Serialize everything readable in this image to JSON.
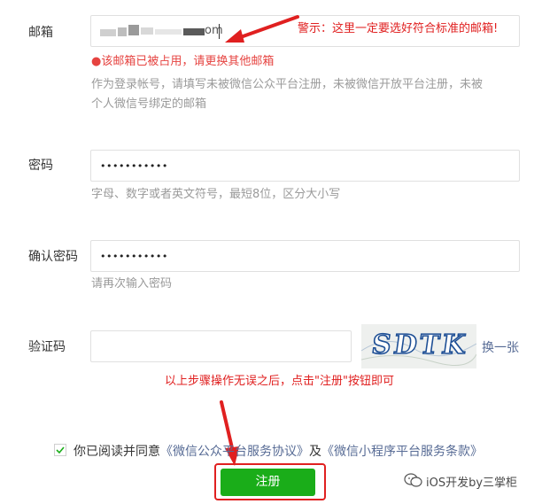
{
  "form": {
    "email": {
      "label": "邮箱",
      "value_tail": "om",
      "error": "●该邮箱已被占用，请更换其他邮箱",
      "hint_line1": "作为登录帐号，请填写未被微信公众平台注册，未被微信开放平台注册，未被",
      "hint_line2": "个人微信号绑定的邮箱"
    },
    "password": {
      "label": "密码",
      "value": "•••••••••••",
      "hint": "字母、数字或者英文符号，最短8位，区分大小写"
    },
    "confirm_password": {
      "label": "确认密码",
      "value": "•••••••••••",
      "hint": "请再次输入密码"
    },
    "captcha": {
      "label": "验证码",
      "image_text": "SDTK",
      "refresh_link": "换一张"
    },
    "agreement": {
      "prefix": "你已阅读并同意",
      "link1": "《微信公众平台服务协议》",
      "middle": "及",
      "link2": "《微信小程序平台服务条款》"
    },
    "submit_label": "注册"
  },
  "annotations": {
    "warning": "警示：这里一定要选好符合标准的邮箱!",
    "instruction": "以上步骤操作无误之后，点击\"注册\"按钮即可"
  },
  "watermark": {
    "text": "iOS开发by三掌柜"
  },
  "colors": {
    "annotation_red": "#e02020",
    "button_green": "#1aad19",
    "link_blue": "#576b95"
  }
}
